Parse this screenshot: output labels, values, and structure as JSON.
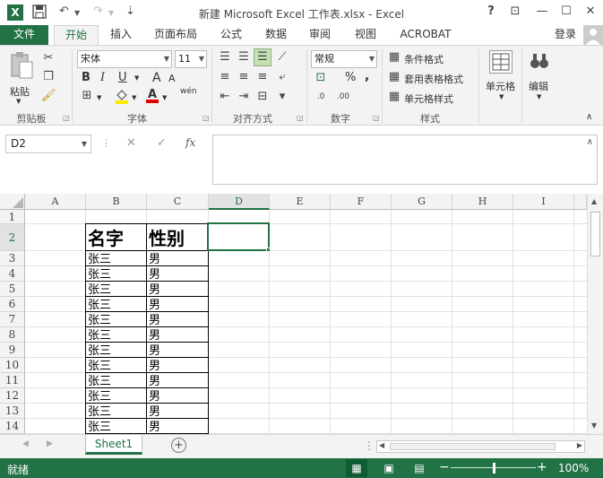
{
  "window": {
    "title": "新建 Microsoft Excel 工作表.xlsx - Excel",
    "help": "?",
    "ribbon_display": "⊡",
    "minimize": "—",
    "maximize": "☐",
    "close": "✕"
  },
  "quick_access": {
    "app_icon": "X",
    "save": "💾",
    "undo": "↶",
    "redo": "↷",
    "customize": "⇣"
  },
  "tabs": [
    "文件",
    "开始",
    "插入",
    "页面布局",
    "公式",
    "数据",
    "审阅",
    "视图",
    "ACROBAT"
  ],
  "active_tab": "开始",
  "login": "登录",
  "ribbon": {
    "clipboard": {
      "paste": "粘贴",
      "label": "剪贴板"
    },
    "font": {
      "name": "宋体",
      "size": "11",
      "bold": "B",
      "italic": "I",
      "underline": "U",
      "grow": "A",
      "shrink": "A",
      "wen": "wén",
      "label": "字体"
    },
    "align": {
      "label": "对齐方式"
    },
    "number": {
      "format": "常规",
      "percent": "%",
      "comma": ",",
      "label": "数字"
    },
    "styles": {
      "conditional": "条件格式",
      "table": "套用表格格式",
      "cell": "单元格样式",
      "label": "样式"
    },
    "cells": {
      "label": "单元格"
    },
    "edit": {
      "label": "编辑"
    }
  },
  "formula_bar": {
    "namebox": "D2",
    "cancel": "✕",
    "enter": "✓",
    "fx": "fx",
    "content": ""
  },
  "columns": [
    "A",
    "B",
    "C",
    "D",
    "E",
    "F",
    "G",
    "H",
    "I"
  ],
  "selected_column": "D",
  "rows": [
    "1",
    "2",
    "3",
    "4",
    "5",
    "6",
    "7",
    "8",
    "9",
    "10",
    "11",
    "12",
    "13",
    "14"
  ],
  "selected_row": "2",
  "table": {
    "header": [
      "名字",
      "性别"
    ],
    "rows": [
      [
        "张三",
        "男"
      ],
      [
        "张三",
        "男"
      ],
      [
        "张三",
        "男"
      ],
      [
        "张三",
        "男"
      ],
      [
        "张三",
        "男"
      ],
      [
        "张三",
        "男"
      ],
      [
        "张三",
        "男"
      ],
      [
        "张三",
        "男"
      ],
      [
        "张三",
        "男"
      ],
      [
        "张三",
        "男"
      ],
      [
        "张三",
        "男"
      ],
      [
        "张三",
        "男"
      ]
    ]
  },
  "sheet": {
    "tab": "Sheet1",
    "add": "+"
  },
  "status": {
    "mode": "就绪",
    "zoom": "100%",
    "zoom_out": "−",
    "zoom_in": "+",
    "zoom_level": 0.5
  },
  "colors": {
    "brand": "#217346"
  }
}
